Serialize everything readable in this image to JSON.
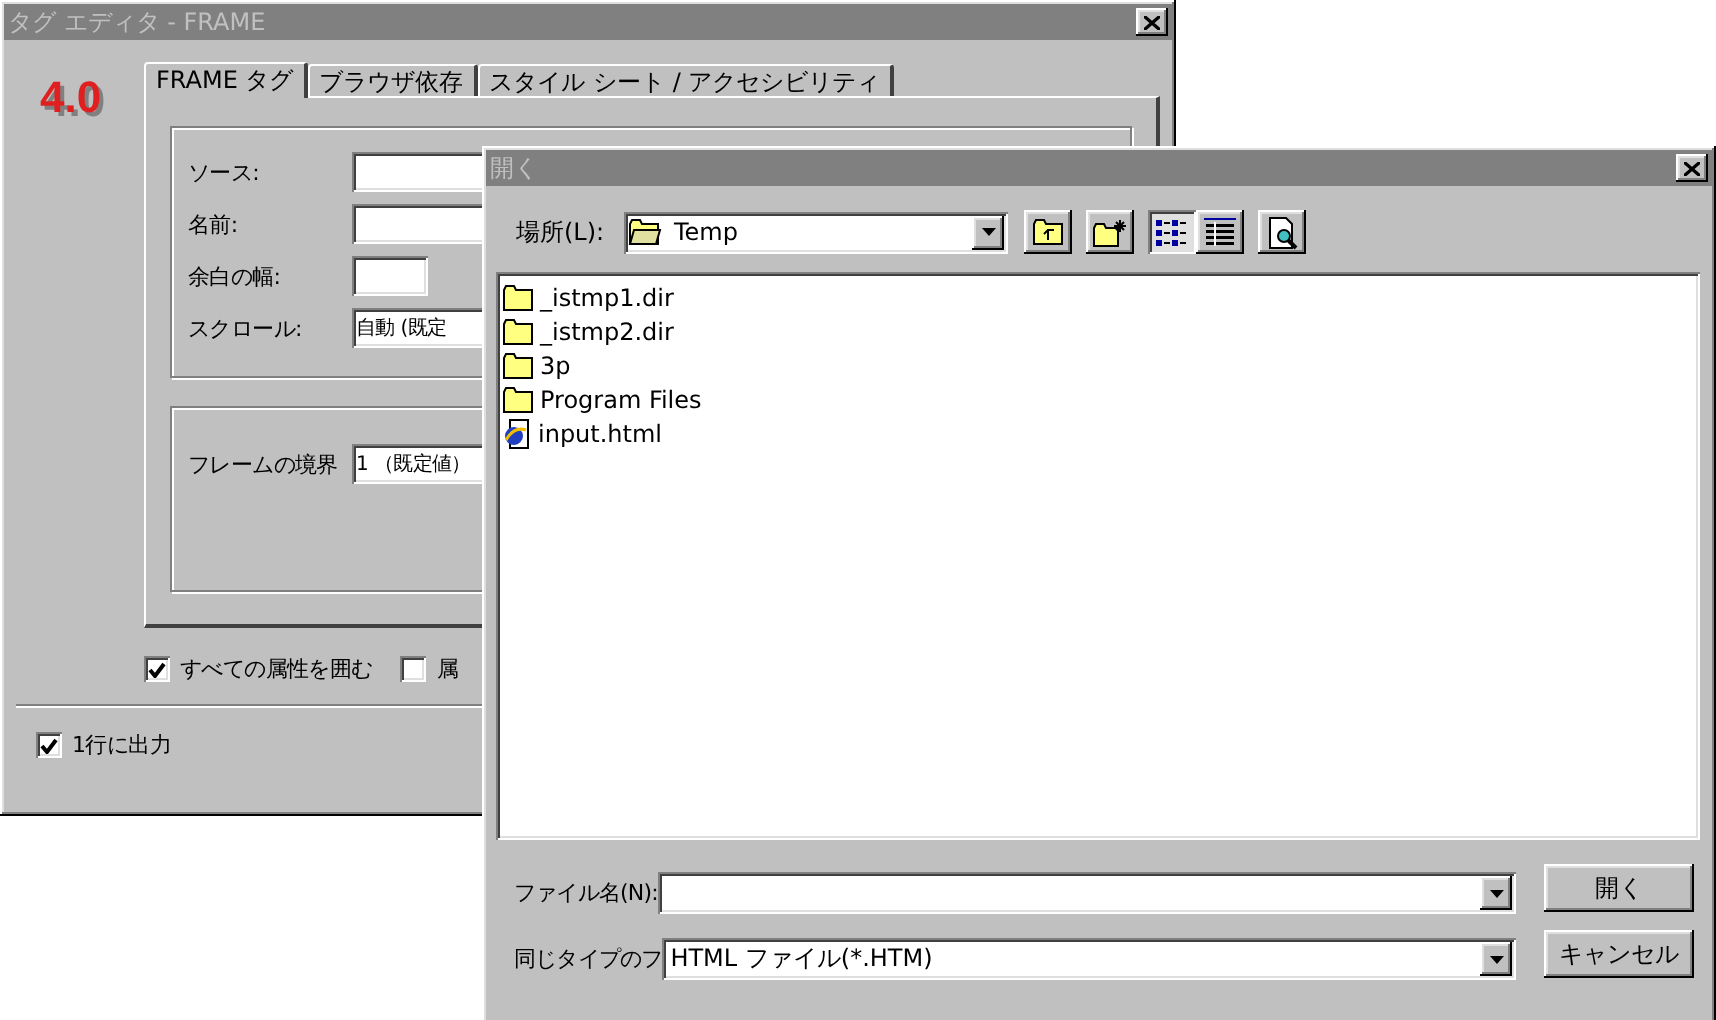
{
  "editor_window": {
    "title": "タグ エディタ - FRAME",
    "logo": "4.0",
    "tabs": [
      {
        "label": "FRAME タグ",
        "selected": true
      },
      {
        "label": "ブラウザ依存",
        "selected": false
      },
      {
        "label": "スタイル シート / アクセシビリティ",
        "selected": false
      }
    ],
    "fields": [
      {
        "label": "ソース:",
        "kind": "text"
      },
      {
        "label": "名前:",
        "kind": "text"
      },
      {
        "label": "余白の幅:",
        "kind": "short"
      },
      {
        "label": "スクロール:",
        "kind": "select",
        "value": "自動 (既定"
      }
    ],
    "border_field": {
      "label": "フレームの境界",
      "value": "1 （既定値）"
    },
    "checkboxes": [
      {
        "label": "すべての属性を囲む",
        "checked": true
      },
      {
        "label": "属",
        "checked": false
      }
    ],
    "output_checkbox": {
      "label": "1行に出力",
      "checked": true
    }
  },
  "open_dialog": {
    "title": "開く",
    "location": {
      "label": "場所(L):",
      "value": "Temp"
    },
    "toolbar": [
      {
        "kind": "up",
        "selected": false
      },
      {
        "kind": "new-folder",
        "selected": false
      },
      {
        "kind": "list",
        "selected": true
      },
      {
        "kind": "details",
        "selected": false
      },
      {
        "kind": "preview",
        "selected": false
      }
    ],
    "files": [
      {
        "name": "_istmp1.dir",
        "kind": "folder"
      },
      {
        "name": "_istmp2.dir",
        "kind": "folder"
      },
      {
        "name": "3p",
        "kind": "folder"
      },
      {
        "name": "Program Files",
        "kind": "folder"
      },
      {
        "name": "input.html",
        "kind": "html"
      }
    ],
    "filename": {
      "label": "ファイル名(N):"
    },
    "filetype": {
      "label": "同じタイプのフ",
      "value": "HTML ファイル(*.HTM)"
    },
    "buttons": [
      "開く",
      "キャンセル"
    ]
  }
}
